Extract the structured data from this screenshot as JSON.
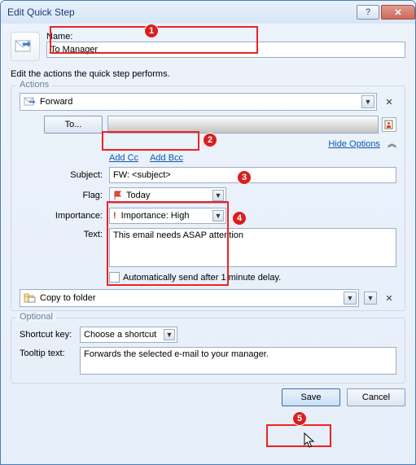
{
  "window": {
    "title": "Edit Quick Step"
  },
  "name": {
    "label": "Name:",
    "value": "To Manager"
  },
  "subtext": "Edit the actions the quick step performs.",
  "actions_legend": "Actions",
  "action1": {
    "label": "Forward"
  },
  "to": {
    "button": "To...",
    "value": ""
  },
  "hide_options": "Hide Options",
  "links": {
    "addcc": "Add Cc",
    "addbcc": "Add Bcc"
  },
  "subject": {
    "label": "Subject:",
    "value": "FW: <subject>"
  },
  "flag": {
    "label": "Flag:",
    "value": "Today"
  },
  "importance": {
    "label": "Importance:",
    "value": "Importance: High"
  },
  "text": {
    "label": "Text:",
    "value": "This email needs ASAP attention"
  },
  "autosend": {
    "label": "Automatically send after 1 minute delay."
  },
  "action2": {
    "label": "Copy to folder"
  },
  "optional_legend": "Optional",
  "shortcut": {
    "label": "Shortcut key:",
    "value": "Choose a shortcut"
  },
  "tooltip": {
    "label": "Tooltip text:",
    "value": "Forwards the selected e-mail to your manager."
  },
  "buttons": {
    "save": "Save",
    "cancel": "Cancel"
  }
}
